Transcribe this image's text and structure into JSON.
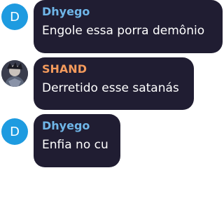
{
  "messages": [
    {
      "sender": "Dhyego",
      "avatar_letter": "D",
      "text": "Engole essa porra demônio",
      "name_color": "#6fb6e8",
      "avatar_color": "#1e9be0"
    },
    {
      "sender": "SHAND",
      "avatar_letter": "",
      "text": "Derretido esse satanás",
      "name_color": "#f39a5c"
    },
    {
      "sender": "Dhyego",
      "avatar_letter": "D",
      "text": "Enfia no cu",
      "name_color": "#6fb6e8",
      "avatar_color": "#1e9be0"
    }
  ],
  "bubble_color": "#201d32"
}
